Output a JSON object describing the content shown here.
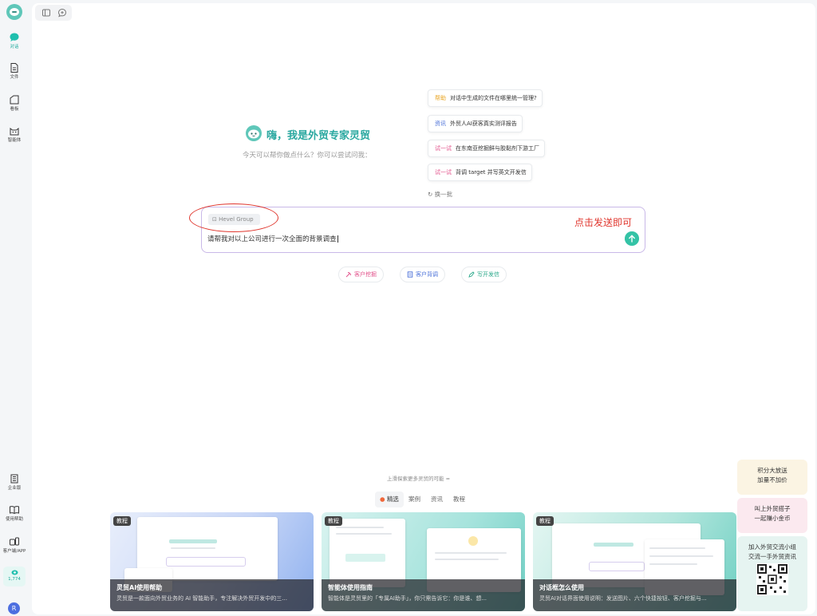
{
  "sidebar": {
    "items": [
      {
        "label": "对话",
        "icon": "chat-bubble-icon",
        "active": true
      },
      {
        "label": "文件",
        "icon": "file-icon"
      },
      {
        "label": "看板",
        "icon": "board-icon"
      },
      {
        "label": "智能体",
        "icon": "agent-cat-icon"
      }
    ],
    "bottom_items": [
      {
        "label": "企业版",
        "icon": "building-icon"
      },
      {
        "label": "使用帮助",
        "icon": "book-icon"
      },
      {
        "label": "客户端/APP",
        "icon": "devices-icon"
      }
    ],
    "credits": "1,774",
    "avatar_initial": "R"
  },
  "greeting": {
    "title": "嗨，我是外贸专家灵贸",
    "subtitle": "今天可以帮你做点什么？你可以尝试问我："
  },
  "suggestions": [
    {
      "tag": "帮助",
      "text": "对话中生成的文件在哪里统一管理?"
    },
    {
      "tag": "资讯",
      "text": "外贸人AI获客真实测评报告"
    },
    {
      "tag": "试一试",
      "text": "在东南亚挖掘鲜与胶黏剂下游工厂"
    },
    {
      "tag": "试一试",
      "text": "背调 target 并写英文开发信"
    }
  ],
  "refresh_label": "换一批",
  "input": {
    "chip_label": "Hevel Group",
    "text": "请帮我对以上公司进行一次全面的背景调查"
  },
  "annotation": {
    "text": "点击发送即可",
    "color": "#e0362d"
  },
  "quick_actions": [
    "客户挖掘",
    "客户背调",
    "写开发信"
  ],
  "explore": {
    "label": "上滑探索更多灵贸的可能 ≈",
    "tabs": [
      "精选",
      "案例",
      "资讯",
      "教程"
    ]
  },
  "cards": [
    {
      "badge": "教程",
      "title": "灵贸AI使用帮助",
      "desc": "灵贸是一款面向外贸业务的 AI 智能助手，专注解决外贸开发中的三..."
    },
    {
      "badge": "教程",
      "title": "智能体使用指南",
      "desc": "智能体是灵贸里的「专属AI助手」，你只需告诉它：你是谁、想..."
    },
    {
      "badge": "教程",
      "title": "对话框怎么使用",
      "desc": "灵贸AI对话界面使用说明：发送图片、六个快捷按钮、客户挖掘与..."
    }
  ],
  "promos": [
    {
      "line1": "积分大放送",
      "line2": "加量不加价"
    },
    {
      "line1": "叫上外贸搭子",
      "line2": "一起赚小金币"
    },
    {
      "line1": "加入外贸交流小组",
      "line2": "交流一手外贸资讯"
    }
  ],
  "colors": {
    "accent": "#2aa8a0",
    "send": "#34c3a6",
    "input_border": "#c9b8e8"
  }
}
